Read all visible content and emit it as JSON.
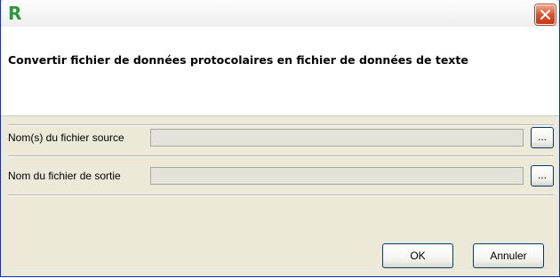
{
  "window": {
    "app_logo": "R",
    "close_glyph": "✕"
  },
  "header": {
    "title": "Convertir fichier de données protocolaires en fichier de données de texte"
  },
  "form": {
    "source_label": "Nom(s) du fichier source",
    "source_value": "",
    "source_browse": "...",
    "output_label": "Nom du fichier de sortie",
    "output_value": "",
    "output_browse": "..."
  },
  "buttons": {
    "ok": "OK",
    "cancel": "Annuler"
  }
}
